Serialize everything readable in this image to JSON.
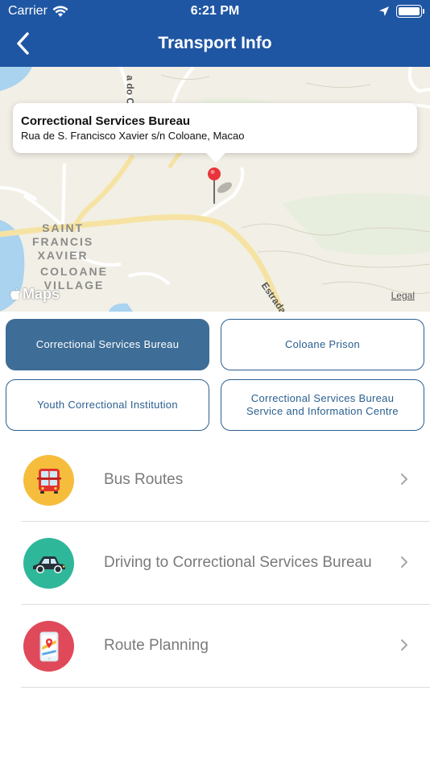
{
  "status_bar": {
    "carrier": "Carrier",
    "time": "6:21 PM"
  },
  "nav": {
    "title": "Transport Info",
    "back_icon": "chevron-left-icon"
  },
  "map": {
    "callout_title": "Correctional Services Bureau",
    "callout_address": "Rua de S. Francisco Xavier s/n Coloane, Macao",
    "label_district_1": "SAINT\nFRANCIS\nXAVIER",
    "label_district_2": "COLOANE\nVILLAGE",
    "road_label_1": "Estrada",
    "road_label_2": "a do Ca",
    "maps_brand": "Maps",
    "legal": "Legal"
  },
  "locations": [
    {
      "label": "Correctional Services Bureau",
      "active": true
    },
    {
      "label": "Coloane Prison",
      "active": false
    },
    {
      "label": "Youth Correctional Institution",
      "active": false
    },
    {
      "label": "Correctional Services Bureau Service and Information Centre",
      "active": false
    }
  ],
  "menu": [
    {
      "label": "Bus Routes",
      "icon": "bus-icon",
      "color": "#f6bd3c"
    },
    {
      "label": "Driving to Correctional Services Bureau",
      "icon": "car-icon",
      "color": "#2fb79a"
    },
    {
      "label": "Route Planning",
      "icon": "map-phone-icon",
      "color": "#e0495a"
    }
  ],
  "colors": {
    "header": "#1f56a3",
    "active_button": "#3e6d97",
    "button_border": "#2a5f8f"
  }
}
